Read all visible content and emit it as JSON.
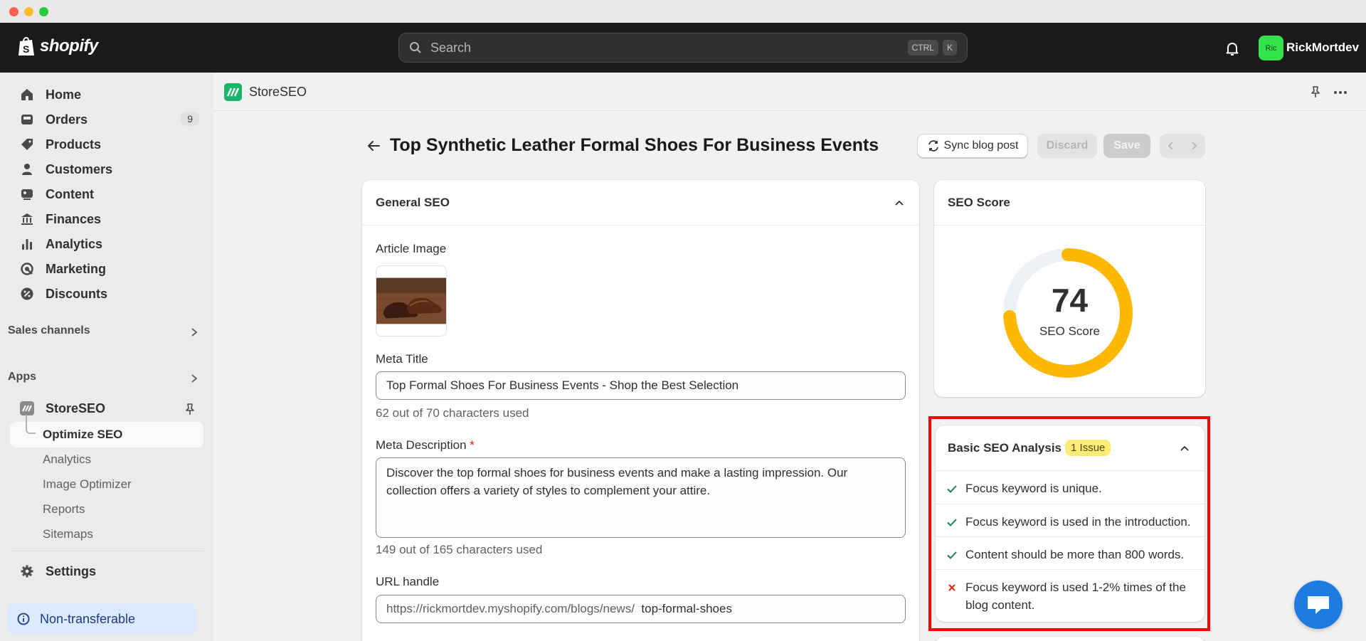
{
  "topbar": {
    "brand": "shopify",
    "search_placeholder": "Search",
    "shortcut_key1": "CTRL",
    "shortcut_key2": "K",
    "avatar_initials": "Ric",
    "username": "RickMortdev"
  },
  "sidebar": {
    "items": [
      {
        "label": "Home",
        "icon": "home-icon"
      },
      {
        "label": "Orders",
        "icon": "orders-icon",
        "badge": "9"
      },
      {
        "label": "Products",
        "icon": "tag-icon"
      },
      {
        "label": "Customers",
        "icon": "person-icon"
      },
      {
        "label": "Content",
        "icon": "content-icon"
      },
      {
        "label": "Finances",
        "icon": "bank-icon"
      },
      {
        "label": "Analytics",
        "icon": "bar-chart-icon"
      },
      {
        "label": "Marketing",
        "icon": "target-icon"
      },
      {
        "label": "Discounts",
        "icon": "discount-icon"
      }
    ],
    "sales_channels_label": "Sales channels",
    "apps_label": "Apps",
    "app": {
      "name": "StoreSEO",
      "subitems": [
        "Optimize SEO",
        "Analytics",
        "Image Optimizer",
        "Reports",
        "Sitemaps"
      ]
    },
    "settings_label": "Settings",
    "non_transferable_label": "Non-transferable"
  },
  "app_header": {
    "app_name": "StoreSEO"
  },
  "page": {
    "title": "Top Synthetic Leather Formal Shoes For Business Events",
    "sync_label": "Sync blog post",
    "discard_label": "Discard",
    "save_label": "Save"
  },
  "general_seo": {
    "heading": "General SEO",
    "article_image_label": "Article Image",
    "meta_title_label": "Meta Title",
    "meta_title_value": "Top Formal Shoes For Business Events - Shop the Best Selection",
    "meta_title_helper": "62 out of 70 characters used",
    "meta_description_label": "Meta Description",
    "required_mark": "*",
    "meta_description_value": "Discover the top formal shoes for business events and make a lasting impression. Our collection offers a variety of styles to complement your attire.",
    "meta_description_helper": "149 out of 165 characters used",
    "url_handle_label": "URL handle",
    "url_prefix": "https://rickmortdev.myshopify.com/blogs/news/",
    "url_handle_value": "top-formal-shoes"
  },
  "seo_score": {
    "heading": "SEO Score",
    "score": 74,
    "score_label": "SEO Score",
    "gauge_color": "#ffb800",
    "track_color": "#eef2f7"
  },
  "analysis": {
    "heading": "Basic SEO Analysis",
    "issue_badge": "1 Issue",
    "checks": [
      {
        "text": "Focus keyword is unique.",
        "status": "pass"
      },
      {
        "text": "Focus keyword is used in the introduction.",
        "status": "pass"
      },
      {
        "text": "Content should be more than 800 words.",
        "status": "pass"
      },
      {
        "text": "Focus keyword is used 1-2% times of the blog content.",
        "status": "fail"
      }
    ]
  },
  "colors": {
    "pass": "#1a7f4b",
    "fail": "#d82c0d",
    "highlight": "#ff0000",
    "accent": "#1e7be0"
  }
}
